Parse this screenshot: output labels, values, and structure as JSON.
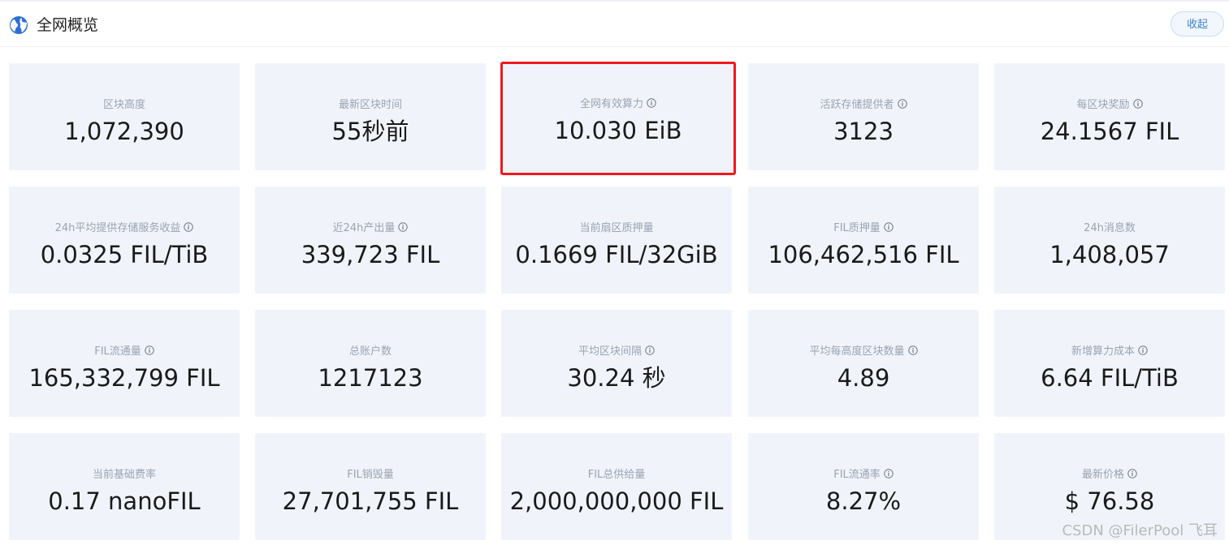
{
  "header": {
    "title": "全网概览",
    "collapse_label": "收起",
    "icon": "globe-icon"
  },
  "stats": [
    {
      "label": "区块高度",
      "value": "1,072,390",
      "info": false
    },
    {
      "label": "最新区块时间",
      "value": "55秒前",
      "info": false
    },
    {
      "label": "全网有效算力",
      "value": "10.030 EiB",
      "info": true,
      "highlighted": true
    },
    {
      "label": "活跃存储提供者",
      "value": "3123",
      "info": true
    },
    {
      "label": "每区块奖励",
      "value": "24.1567 FIL",
      "info": true
    },
    {
      "label": "24h平均提供存储服务收益",
      "value": "0.0325 FIL/TiB",
      "info": true
    },
    {
      "label": "近24h产出量",
      "value": "339,723 FIL",
      "info": true
    },
    {
      "label": "当前扇区质押量",
      "value": "0.1669 FIL/32GiB",
      "info": false
    },
    {
      "label": "FIL质押量",
      "value": "106,462,516 FIL",
      "info": true
    },
    {
      "label": "24h消息数",
      "value": "1,408,057",
      "info": false
    },
    {
      "label": "FIL流通量",
      "value": "165,332,799 FIL",
      "info": true
    },
    {
      "label": "总账户数",
      "value": "1217123",
      "info": false
    },
    {
      "label": "平均区块间隔",
      "value": "30.24 秒",
      "info": true
    },
    {
      "label": "平均每高度区块数量",
      "value": "4.89",
      "info": true
    },
    {
      "label": "新增算力成本",
      "value": "6.64 FIL/TiB",
      "info": true
    },
    {
      "label": "当前基础费率",
      "value": "0.17 nanoFIL",
      "info": false
    },
    {
      "label": "FIL销毁量",
      "value": "27,701,755 FIL",
      "info": false
    },
    {
      "label": "FIL总供给量",
      "value": "2,000,000,000 FIL",
      "info": false
    },
    {
      "label": "FIL流通率",
      "value": "8.27%",
      "info": true
    },
    {
      "label": "最新价格",
      "value": "$ 76.58",
      "info": true
    }
  ],
  "colors": {
    "highlight_border": "#f0181f",
    "card_bg": "#f0f4fa",
    "accent": "#3b82d6"
  },
  "watermark": "CSDN @FilerPool 飞耳"
}
